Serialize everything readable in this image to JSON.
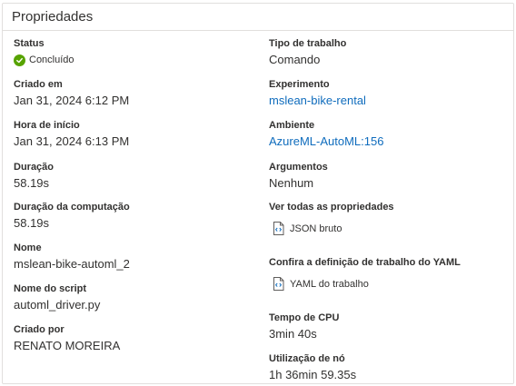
{
  "panel": {
    "title": "Propriedades"
  },
  "left": {
    "status": {
      "label": "Status",
      "value": "Concluído",
      "color": "#57a300",
      "icon": "check-circle-icon"
    },
    "created": {
      "label": "Criado em",
      "value": "Jan 31, 2024 6:12 PM"
    },
    "start": {
      "label": "Hora de início",
      "value": "Jan 31, 2024 6:13 PM"
    },
    "duration": {
      "label": "Duração",
      "value": "58.19s"
    },
    "compute_duration": {
      "label": "Duração da computação",
      "value": "58.19s"
    },
    "name": {
      "label": "Nome",
      "value": "mslean-bike-automl_2"
    },
    "script": {
      "label": "Nome do script",
      "value": "automl_driver.py"
    },
    "created_by": {
      "label": "Criado por",
      "value": "RENATO MOREIRA"
    }
  },
  "right": {
    "job_type": {
      "label": "Tipo de trabalho",
      "value": "Comando"
    },
    "experiment": {
      "label": "Experimento",
      "value": "mslean-bike-rental"
    },
    "environment": {
      "label": "Ambiente",
      "value": "AzureML-AutoML:156"
    },
    "arguments": {
      "label": "Argumentos",
      "value": "Nenhum"
    },
    "all_props": {
      "label": "Ver todas as propriedades",
      "link": "JSON bruto",
      "icon": "file-code-icon"
    },
    "yaml": {
      "label": "Confira a definição de trabalho do YAML",
      "link": "YAML do trabalho",
      "icon": "file-code-icon"
    },
    "cpu_time": {
      "label": "Tempo de CPU",
      "value": "3min 40s"
    },
    "node_usage": {
      "label": "Utilização de nó",
      "value": "1h 36min 59.35s"
    }
  },
  "colors": {
    "link": "#0f6cbd",
    "border": "#e1dfdd",
    "text": "#323130"
  }
}
